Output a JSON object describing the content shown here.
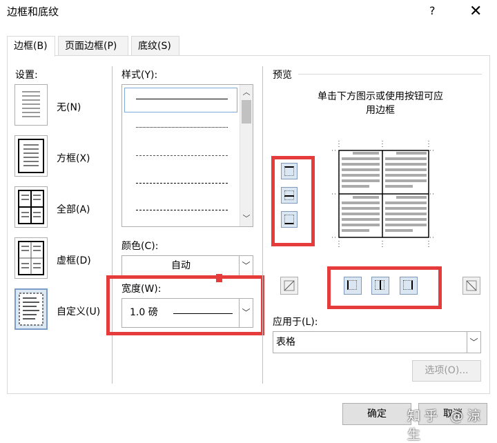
{
  "window": {
    "title": "边框和底纹",
    "help": "?",
    "close": "✕"
  },
  "tabs": [
    "边框(B)",
    "页面边框(P)",
    "底纹(S)"
  ],
  "settings": {
    "label": "设置:",
    "items": [
      "无(N)",
      "方框(X)",
      "全部(A)",
      "虚框(D)",
      "自定义(U)"
    ]
  },
  "style": {
    "label": "样式(Y):",
    "lines": [
      "solid",
      "dotted",
      "dashed-fine",
      "dashed",
      "dash-dot"
    ]
  },
  "color": {
    "label": "颜色(C):",
    "value": "自动"
  },
  "width": {
    "label": "宽度(W):",
    "value": "1.0 磅"
  },
  "preview": {
    "label": "预览",
    "hint_line1": "单击下方图示或使用按钮可应",
    "hint_line2": "用边框"
  },
  "apply_to": {
    "label": "应用于(L):",
    "value": "表格"
  },
  "buttons": {
    "options": "选项(O)...",
    "ok": "确定",
    "cancel": "取消"
  },
  "watermark": "知乎 @涼生",
  "colors": {
    "highlight": "#e53b3b",
    "selected_bg": "#dde8f5",
    "border": "#adadad"
  }
}
